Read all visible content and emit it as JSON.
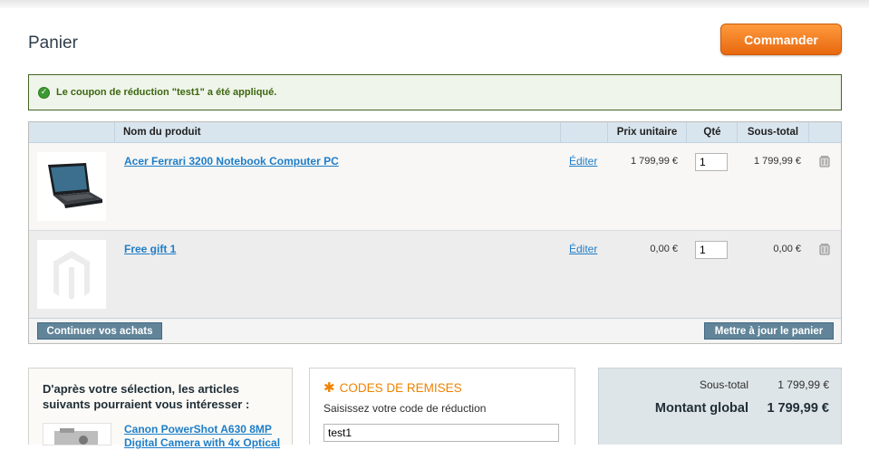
{
  "page": {
    "title": "Panier",
    "checkout_label": "Commander"
  },
  "message": {
    "text": "Le coupon de réduction \"test1\" a été appliqué."
  },
  "cart": {
    "columns": {
      "name": "Nom du produit",
      "unit_price": "Prix unitaire",
      "qty": "Qté",
      "subtotal": "Sous-total"
    },
    "items": [
      {
        "name": "Acer Ferrari 3200 Notebook Computer PC",
        "edit": "Éditer",
        "unit_price": "1 799,99 €",
        "qty": "1",
        "subtotal": "1 799,99 €"
      },
      {
        "name": "Free gift 1",
        "edit": "Éditer",
        "unit_price": "0,00 €",
        "qty": "1",
        "subtotal": "0,00 €"
      }
    ],
    "continue_label": "Continuer vos achats",
    "update_label": "Mettre à jour le panier"
  },
  "crosssell": {
    "heading": "D'après votre sélection, les articles suivants pourraient vous intéresser :",
    "product_link": "Canon PowerShot A630 8MP Digital Camera with 4x Optical"
  },
  "discount": {
    "heading": "CODES DE REMISES",
    "label": "Saisissez votre code de réduction",
    "value": "test1"
  },
  "totals": {
    "subtotal_label": "Sous-total",
    "subtotal_value": "1 799,99 €",
    "grand_label": "Montant global",
    "grand_value": "1 799,99 €"
  },
  "colors": {
    "accent": "#f18200",
    "link": "#1e7ec8",
    "success": "#3d6611"
  }
}
